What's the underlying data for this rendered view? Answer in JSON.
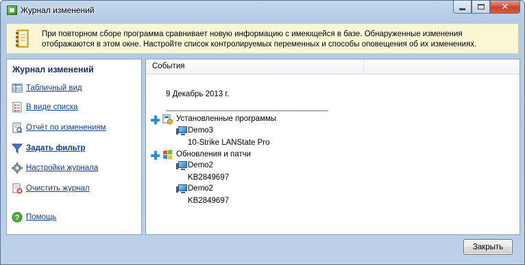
{
  "window": {
    "title": "Журнал изменений",
    "close_glyph": "✕"
  },
  "info": {
    "line1": "При повторном сборе программа сравнивает новую информацию с имеющейся в базе. Обнаруженные изменения",
    "line2": "отображаются в этом окне. Настройте список контролируемых переменных и способы оповещения об их изменениях."
  },
  "sidebar": {
    "title": "Журнал изменений",
    "items": [
      {
        "label": "Табличный вид",
        "icon": "table-view-icon"
      },
      {
        "label": "В виде списка",
        "icon": "list-view-icon"
      },
      {
        "label": "Отчёт по изменениям",
        "icon": "report-icon"
      },
      {
        "label": "Задать фильтр",
        "icon": "filter-icon"
      },
      {
        "label": "Настройки журнала",
        "icon": "gear-icon"
      },
      {
        "label": "Очистить журнал",
        "icon": "clear-log-icon"
      },
      {
        "label": "Помощь",
        "icon": "help-icon"
      }
    ]
  },
  "events": {
    "column_header": "События",
    "date": "9 Декабрь 2013 г.",
    "separator": "_____________________________________",
    "groups": [
      {
        "label": "Установленные программы",
        "icon": "installed-programs-icon",
        "entries": [
          {
            "computer": "Demo3",
            "detail": "10-Strike LANState Pro"
          }
        ]
      },
      {
        "label": "Обновления и патчи",
        "icon": "windows-updates-icon",
        "entries": [
          {
            "computer": "Demo2",
            "detail": "KB2849697"
          },
          {
            "computer": "Demo2",
            "detail": "KB2849697"
          }
        ]
      }
    ]
  },
  "footer": {
    "close_label": "Закрыть"
  },
  "colors": {
    "link": "#0b3f9a",
    "title_blue": "#10306e",
    "info_bg": "#fbf7d6",
    "frame": "#bcd0e8"
  }
}
